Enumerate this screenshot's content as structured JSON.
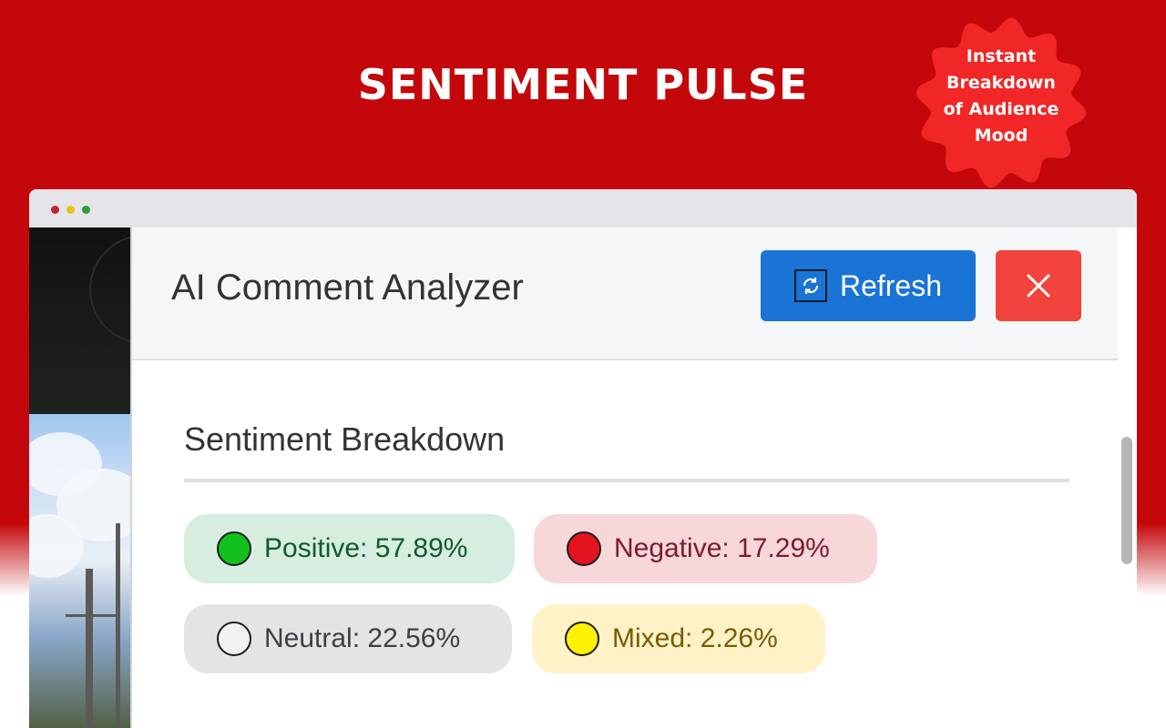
{
  "promo": {
    "title": "SENTIMENT PULSE",
    "badge_lines": [
      "Instant",
      "Breakdown",
      "of Audience",
      "Mood"
    ]
  },
  "colors": {
    "background": "#c4070a",
    "badge": "#f12626",
    "refresh_button": "#1a74d6",
    "close_button": "#f2433c"
  },
  "panel": {
    "title": "AI Comment Analyzer",
    "refresh_label": "Refresh",
    "refresh_icon": "refresh-icon",
    "close_icon": "close-icon"
  },
  "breakdown": {
    "title": "Sentiment Breakdown",
    "items": [
      {
        "label": "Positive: 57.89%",
        "dot_color": "#12c11d"
      },
      {
        "label": "Negative: 17.29%",
        "dot_color": "#e3131f"
      },
      {
        "label": "Neutral: 22.56%",
        "dot_color": "#f2f2f2"
      },
      {
        "label": "Mixed: 2.26%",
        "dot_color": "#fff200"
      }
    ]
  }
}
